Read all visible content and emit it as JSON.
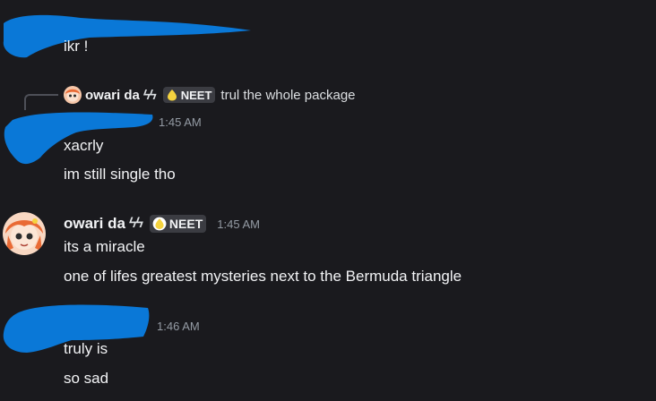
{
  "messages": [
    {
      "text": "ikr !"
    },
    {
      "reply": {
        "author": "owari da",
        "glyph": "ϟϟ",
        "tag": "NEET",
        "text": "trul the whole package"
      },
      "time": "1:45 AM",
      "lines": [
        "xacrly",
        "im still single tho"
      ]
    },
    {
      "author": "owari da",
      "glyph": "ϟϟ",
      "tag": "NEET",
      "time": "1:45 AM",
      "lines": [
        "its a miracle",
        "one of lifes greatest mysteries next to the Bermuda triangle"
      ]
    },
    {
      "time": "1:46 AM",
      "lines": [
        "truly is",
        "so sad"
      ]
    }
  ],
  "colors": {
    "background": "#1a1a1e",
    "text": "#f2f3f5",
    "timestamp": "#949ba4",
    "redaction": "#0a78d7",
    "tag_bg": "#3b3c42"
  },
  "icons": [
    "redacted-avatar",
    "redacted-username",
    "owari-avatar",
    "neet-tag-icon",
    "reply-connector"
  ]
}
